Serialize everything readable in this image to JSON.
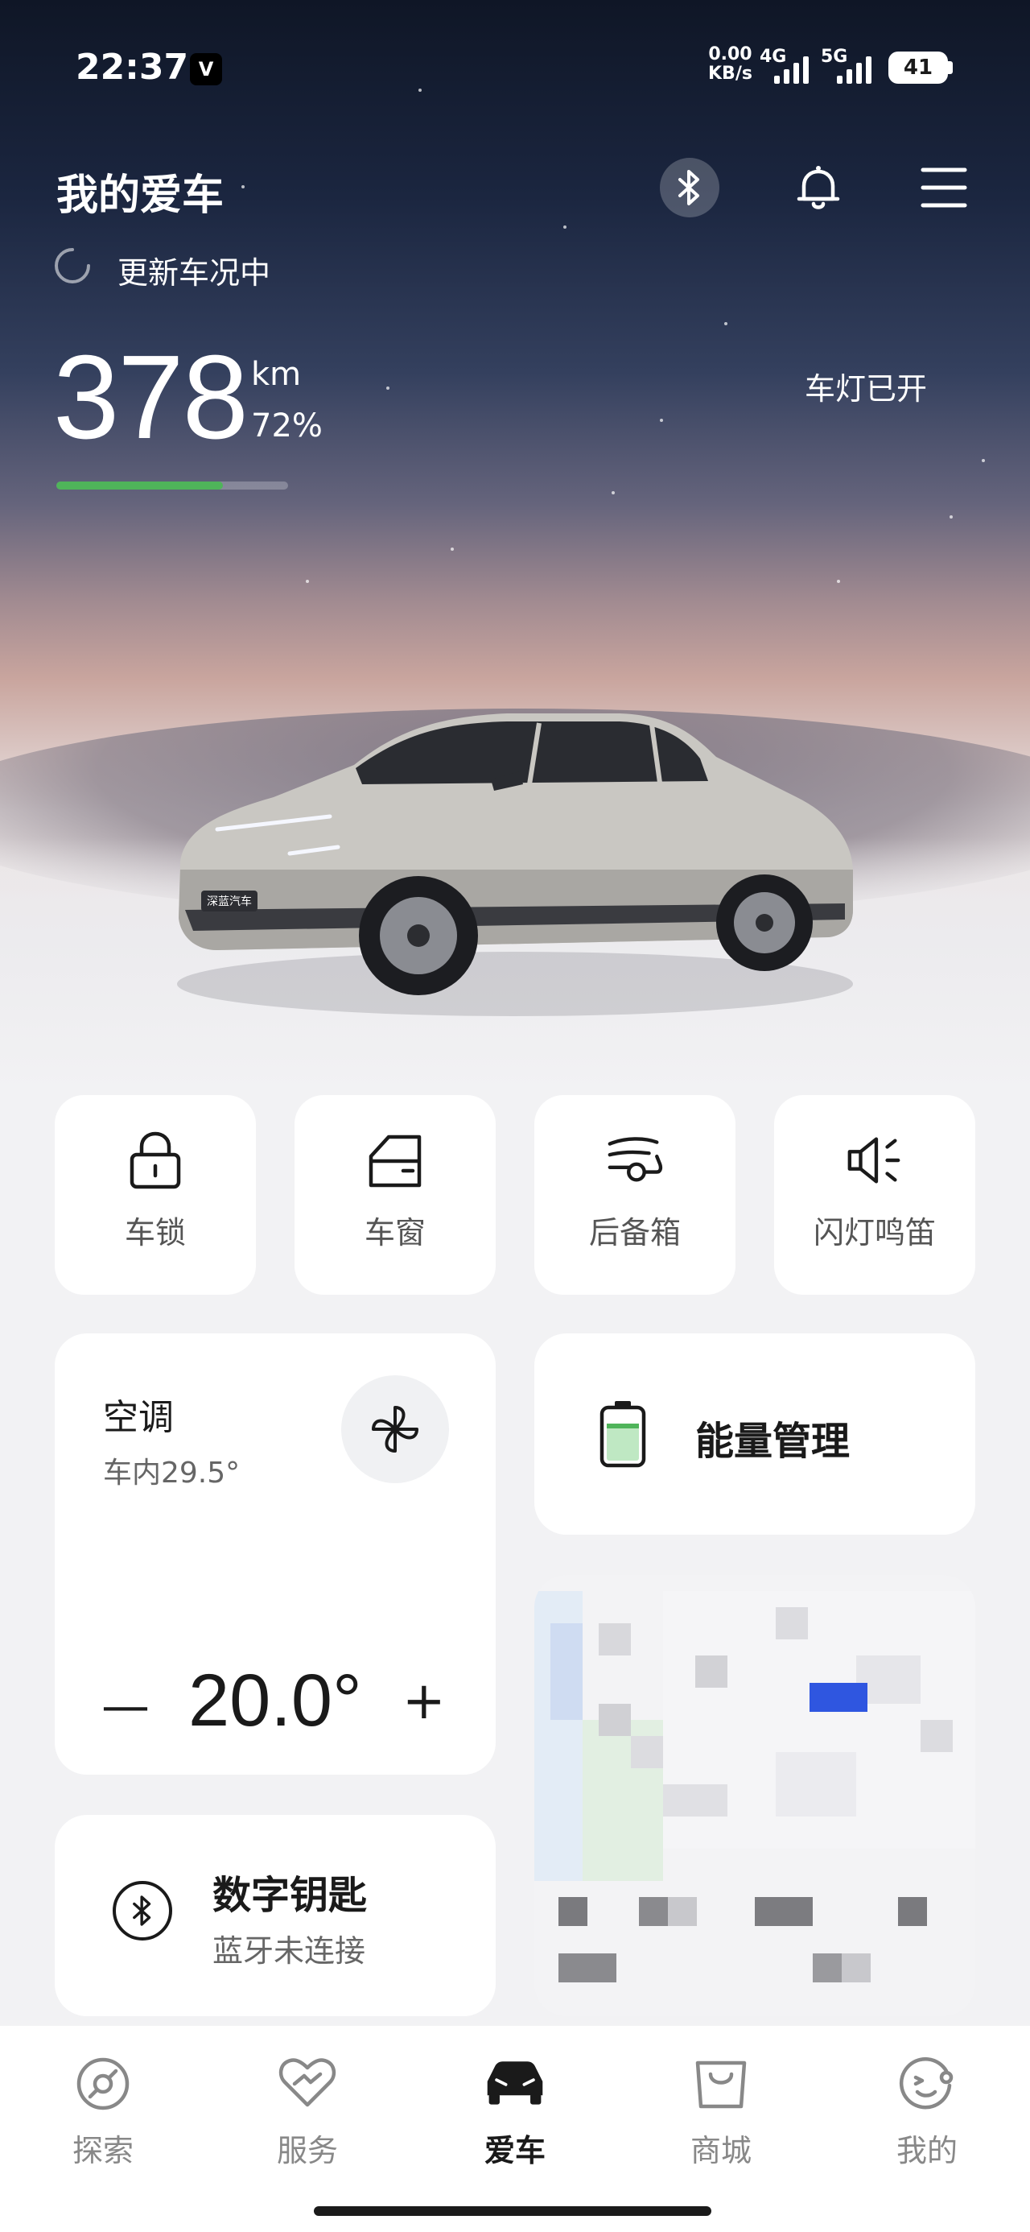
{
  "status_bar": {
    "time": "22:37",
    "app_badge": "V",
    "net_speed_value": "0.00",
    "net_speed_unit": "KB/s",
    "sig1_label": "4G",
    "sig2_label": "5G",
    "battery": "41"
  },
  "header": {
    "title": "我的爱车",
    "refresh_text": "更新车况中",
    "icons": [
      "bluetooth-icon",
      "bell-icon",
      "menu-icon"
    ]
  },
  "range": {
    "value": "378",
    "unit": "km",
    "percent_text": "72%",
    "percent": 0.72,
    "lights_status": "车灯已开"
  },
  "car": {
    "badge": "深蓝汽车"
  },
  "quick_actions": [
    {
      "label": "车锁",
      "icon": "lock-icon"
    },
    {
      "label": "车窗",
      "icon": "window-icon"
    },
    {
      "label": "后备箱",
      "icon": "trunk-icon"
    },
    {
      "label": "闪灯鸣笛",
      "icon": "horn-icon"
    }
  ],
  "climate": {
    "title": "空调",
    "inside_temp": "车内29.5°",
    "set_temp": "20.0°",
    "minus": "—",
    "plus": "+"
  },
  "energy": {
    "label": "能量管理"
  },
  "digital_key": {
    "title": "数字钥匙",
    "status": "蓝牙未连接"
  },
  "tabs": [
    {
      "label": "探索",
      "icon": "explore-icon",
      "active": false
    },
    {
      "label": "服务",
      "icon": "service-icon",
      "active": false
    },
    {
      "label": "爱车",
      "icon": "car-icon",
      "active": true
    },
    {
      "label": "商城",
      "icon": "shop-icon",
      "active": false
    },
    {
      "label": "我的",
      "icon": "profile-icon",
      "active": false
    }
  ],
  "colors": {
    "accent_green": "#4fb45a",
    "map_marker": "#2f56e0"
  }
}
